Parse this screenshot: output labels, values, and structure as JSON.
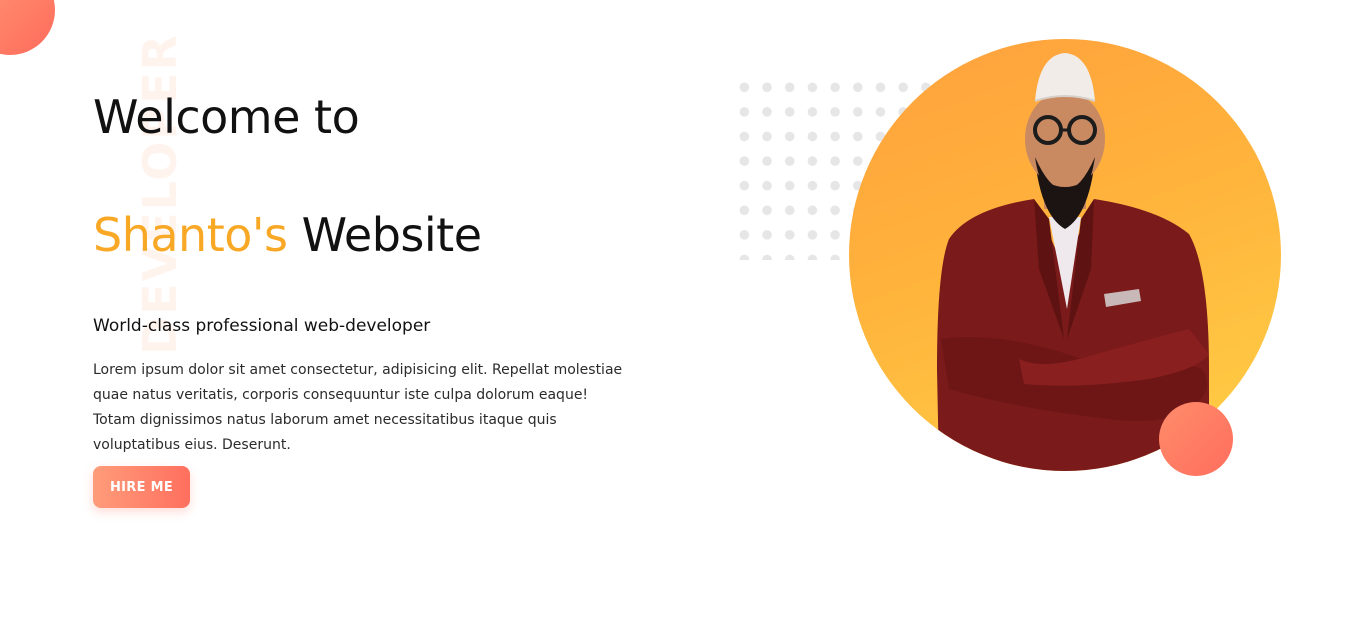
{
  "side_word": "DEVELOPER",
  "hero": {
    "title_line1": "Welcome to",
    "title_name": "Shanto's",
    "title_rest": "Website",
    "tagline": "World-class professional web-developer",
    "description": "Lorem ipsum dolor sit amet consectetur, adipisicing elit. Repellat molestiae quae natus veritatis, corporis consequuntur iste culpa dolorum eaque! Totam dignissimos natus laborum amet necessitatibus itaque quis voluptatibus eius. Deserunt.",
    "cta_label": "HIRE ME"
  },
  "colors": {
    "accent": "#f9a826",
    "button_start": "#ff9c7a",
    "button_end": "#ff6f5e",
    "portrait_bg": "#ffb33c",
    "text": "#111111"
  }
}
